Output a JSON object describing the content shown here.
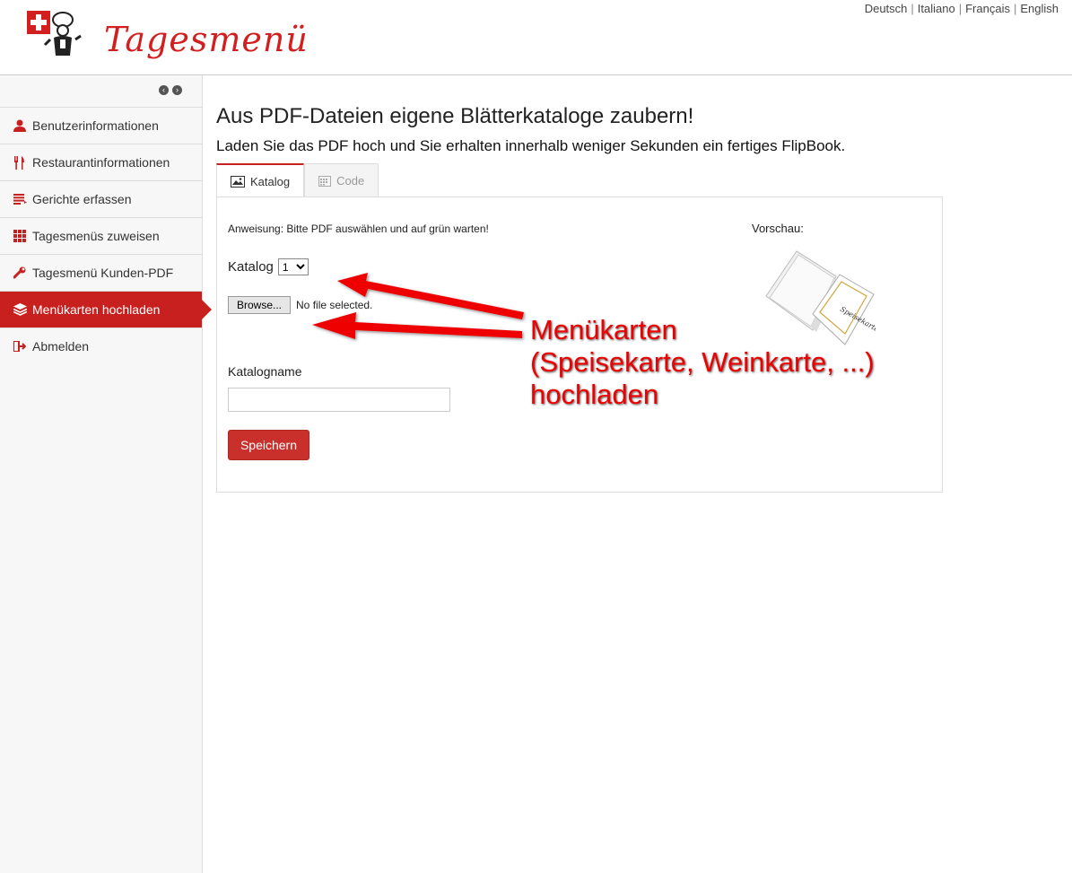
{
  "header": {
    "brand": "Tagesmenü",
    "languages": [
      "Deutsch",
      "Italiano",
      "Français",
      "English"
    ]
  },
  "sidebar": {
    "items": [
      {
        "label": "Benutzerinformationen",
        "icon": "user-icon"
      },
      {
        "label": "Restaurantinformationen",
        "icon": "cutlery-icon"
      },
      {
        "label": "Gerichte erfassen",
        "icon": "list-icon"
      },
      {
        "label": "Tagesmenüs zuweisen",
        "icon": "grid-icon"
      },
      {
        "label": "Tagesmenü Kunden-PDF",
        "icon": "wrench-icon"
      },
      {
        "label": "Menükarten hochladen",
        "icon": "layers-icon",
        "active": true
      },
      {
        "label": "Abmelden",
        "icon": "logout-icon"
      }
    ]
  },
  "main": {
    "title": "Aus PDF-Dateien eigene Blätterkataloge zaubern!",
    "subtitle": "Laden Sie das PDF hoch und Sie erhalten innerhalb weniger Sekunden ein fertiges FlipBook.",
    "tabs": [
      {
        "label": "Katalog",
        "icon": "image-icon",
        "active": true
      },
      {
        "label": "Code",
        "icon": "calendar-icon",
        "active": false
      }
    ],
    "instruction": "Anweisung: Bitte PDF auswählen und auf grün warten!",
    "preview_label": "Vorschau:",
    "katalog_label": "Katalog",
    "katalog_selected": "1",
    "browse_label": "Browse...",
    "file_status": "No file selected.",
    "katalogname_label": "Katalogname",
    "katalogname_value": "",
    "save_label": "Speichern"
  },
  "annotation": {
    "lines": [
      "Menükarten",
      "(Speisekarte, Weinkarte, ...)",
      "hochladen"
    ]
  },
  "colors": {
    "accent": "#c8201f",
    "annotation": "#e00000",
    "save_button": "#c9302c"
  }
}
